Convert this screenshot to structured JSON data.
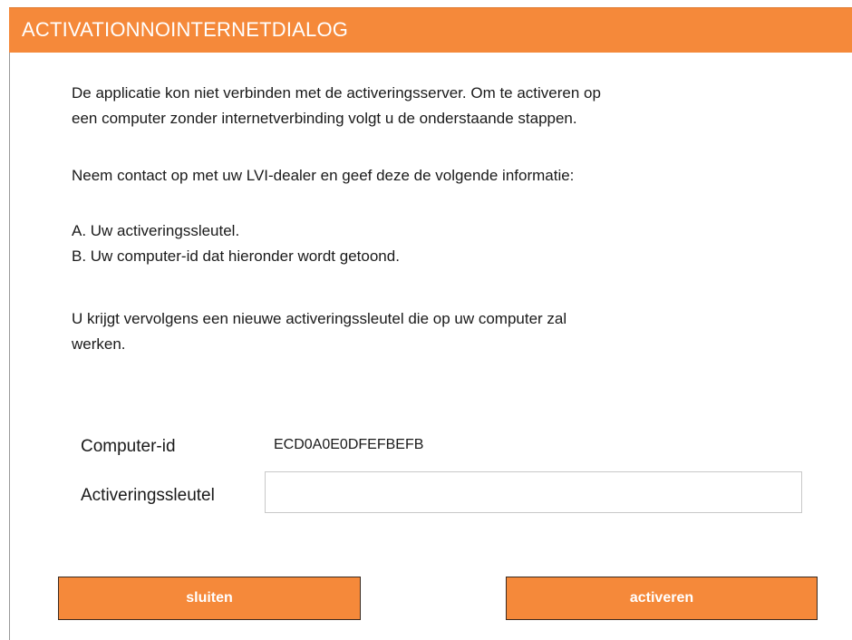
{
  "dialog": {
    "title": "ACTIVATIONNOINTERNETDIALOG",
    "accent_color": "#f5893a"
  },
  "body": {
    "intro_line1": "De applicatie kon niet verbinden met de activeringsserver. Om te activeren op",
    "intro_line2": "een computer zonder internetverbinding volgt u de onderstaande stappen.",
    "contact": "Neem contact op met uw LVI-dealer en geef deze de volgende informatie:",
    "item_a": "A. Uw activeringssleutel.",
    "item_b": "B. Uw computer-id dat hieronder wordt getoond.",
    "result_line1": "U krijgt vervolgens een nieuwe activeringssleutel die op uw computer zal",
    "result_line2": "werken."
  },
  "fields": {
    "computer_id_label": "Computer-id",
    "computer_id_value": "ECD0A0E0DFEFBEFB",
    "activation_key_label": "Activeringssleutel",
    "activation_key_value": "",
    "activation_key_placeholder": ""
  },
  "buttons": {
    "close_label": "sluiten",
    "activate_label": "activeren"
  }
}
